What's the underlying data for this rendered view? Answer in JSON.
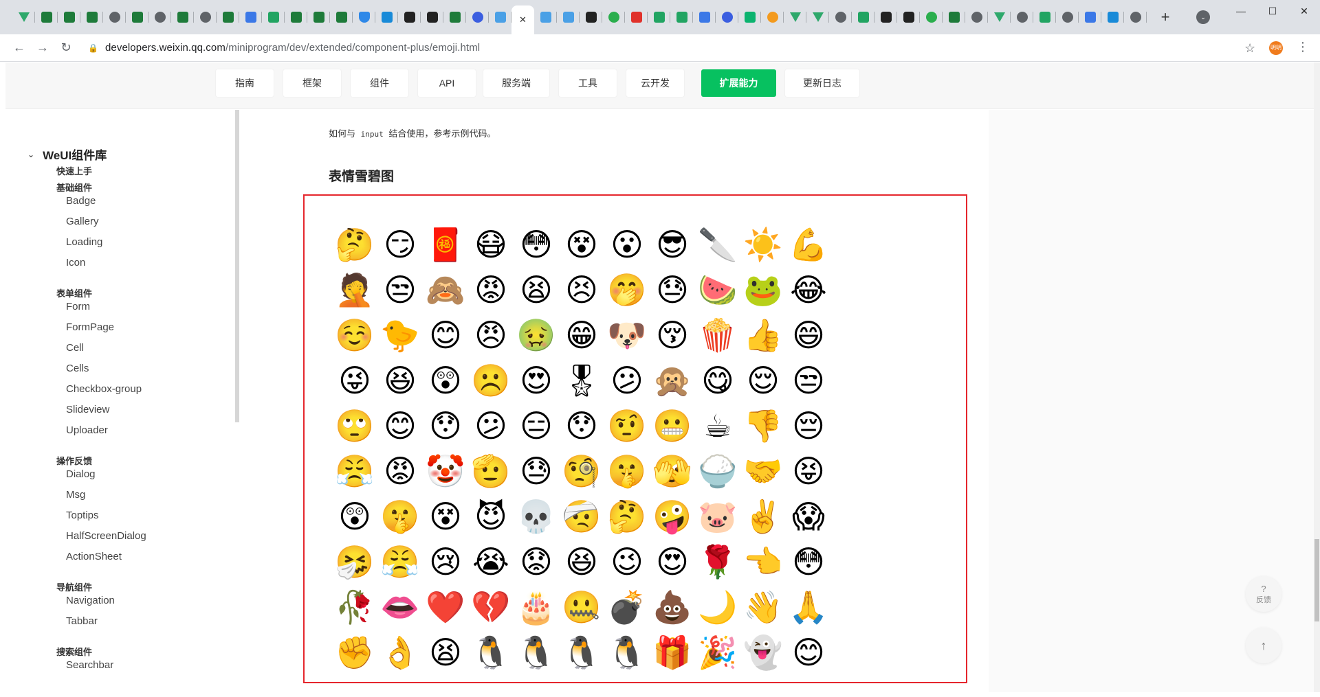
{
  "browser": {
    "tabs": [
      {
        "icon": "vue-icon"
      },
      {
        "icon": "app-icon"
      },
      {
        "icon": "app-icon"
      },
      {
        "icon": "app-icon"
      },
      {
        "icon": "globe-icon"
      },
      {
        "icon": "app-icon"
      },
      {
        "icon": "globe-icon"
      },
      {
        "icon": "app-icon"
      },
      {
        "icon": "globe-icon"
      },
      {
        "icon": "app-icon"
      },
      {
        "icon": "doc-icon"
      },
      {
        "icon": "sheet-icon"
      },
      {
        "icon": "app-icon"
      },
      {
        "icon": "app-icon"
      },
      {
        "icon": "app-icon"
      },
      {
        "icon": "shield-icon"
      },
      {
        "icon": "bing-icon"
      },
      {
        "icon": "dark-icon"
      },
      {
        "icon": "dark-icon"
      },
      {
        "icon": "app-icon"
      },
      {
        "icon": "paw-icon"
      },
      {
        "icon": "grid-icon"
      },
      {
        "icon": "active-tab",
        "active": true
      },
      {
        "icon": "grid-icon"
      },
      {
        "icon": "grid-icon"
      },
      {
        "icon": "github-icon"
      },
      {
        "icon": "wechat-icon"
      },
      {
        "icon": "jetbrains-icon"
      },
      {
        "icon": "sheet-icon"
      },
      {
        "icon": "sheet-icon"
      },
      {
        "icon": "doc-icon"
      },
      {
        "icon": "paw-icon"
      },
      {
        "icon": "green-icon"
      },
      {
        "icon": "orange-icon"
      },
      {
        "icon": "vue-icon"
      },
      {
        "icon": "vue-icon"
      },
      {
        "icon": "globe-icon"
      },
      {
        "icon": "sheet-icon"
      },
      {
        "icon": "tool-icon"
      },
      {
        "icon": "tool-icon"
      },
      {
        "icon": "wechat-icon"
      },
      {
        "icon": "app-icon"
      },
      {
        "icon": "globe-icon"
      },
      {
        "icon": "vue-icon"
      },
      {
        "icon": "globe-icon"
      },
      {
        "icon": "sheet-icon"
      },
      {
        "icon": "globe-icon"
      },
      {
        "icon": "doc-icon"
      },
      {
        "icon": "bing-icon"
      },
      {
        "icon": "globe-icon"
      }
    ],
    "url_host": "developers.weixin.qq.com",
    "url_path": "/miniprogram/dev/extended/component-plus/emoji.html",
    "profile_label": "明明"
  },
  "topnav": [
    {
      "label": "指南"
    },
    {
      "label": "框架"
    },
    {
      "label": "组件"
    },
    {
      "label": "API"
    },
    {
      "label": "服务端"
    },
    {
      "label": "工具"
    },
    {
      "label": "云开发"
    },
    {
      "label": "扩展能力",
      "active": true
    },
    {
      "label": "更新日志"
    }
  ],
  "sidebar": {
    "title": "WeUI组件库",
    "groups": [
      {
        "label": "快速上手",
        "items": []
      },
      {
        "label": "基础组件",
        "items": [
          "Badge",
          "Gallery",
          "Loading",
          "Icon"
        ]
      },
      {
        "label": "表单组件",
        "items": [
          "Form",
          "FormPage",
          "Cell",
          "Cells",
          "Checkbox-group",
          "Slideview",
          "Uploader"
        ]
      },
      {
        "label": "操作反馈",
        "items": [
          "Dialog",
          "Msg",
          "Toptips",
          "HalfScreenDialog",
          "ActionSheet"
        ]
      },
      {
        "label": "导航组件",
        "items": [
          "Navigation",
          "Tabbar"
        ]
      },
      {
        "label": "搜索组件",
        "items": [
          "Searchbar"
        ]
      }
    ]
  },
  "content": {
    "hint_prefix": "如何与",
    "hint_code": "input",
    "hint_suffix": "结合使用，参考示例代码。",
    "section_title": "表情雪碧图",
    "emojis": [
      "🤔",
      "😏",
      "🧧",
      "😷",
      "😳",
      "😵",
      "😮",
      "😎",
      "🔪",
      "☀️",
      "💪",
      "🤦",
      "😒",
      "🙈",
      "😡",
      "😫",
      "😣",
      "🤭",
      "😓",
      "🍉",
      "🐸",
      "😂",
      "☺️",
      "🐤",
      "😊",
      "😠",
      "🤢",
      "😁",
      "🐶",
      "😚",
      "🍿",
      "👍",
      "😄",
      "😜",
      "😆",
      "😲",
      "☹️",
      "😍",
      "🎖",
      "😕",
      "🙊",
      "😋",
      "😌",
      "😒",
      "🙄",
      "😊",
      "😯",
      "😕",
      "😑",
      "😯",
      "🤨",
      "😬",
      "☕",
      "👎",
      "😔",
      "😤",
      "😡",
      "🤡",
      "🫡",
      "😓",
      "🧐",
      "🤫",
      "🫣",
      "🍚",
      "🤝",
      "😝",
      "😲",
      "🤫",
      "😵",
      "😈",
      "💀",
      "🤕",
      "🤔",
      "🤪",
      "🐷",
      "✌️",
      "😱",
      "🤧",
      "😤",
      "😢",
      "😭",
      "😟",
      "😆",
      "😉",
      "😍",
      "🌹",
      "👈",
      "😳",
      "🥀",
      "👄",
      "❤️",
      "💔",
      "🎂",
      "🤐",
      "💣",
      "💩",
      "🌙",
      "👋",
      "🙏",
      "✊",
      "👌",
      "😫",
      "🐧",
      "🐧",
      "🐧",
      "🐧",
      "🎁",
      "🎉",
      "👻",
      "😊"
    ]
  },
  "floating": {
    "feedback_label": "反馈",
    "feedback_icon": "?",
    "totop_icon": "↑"
  }
}
